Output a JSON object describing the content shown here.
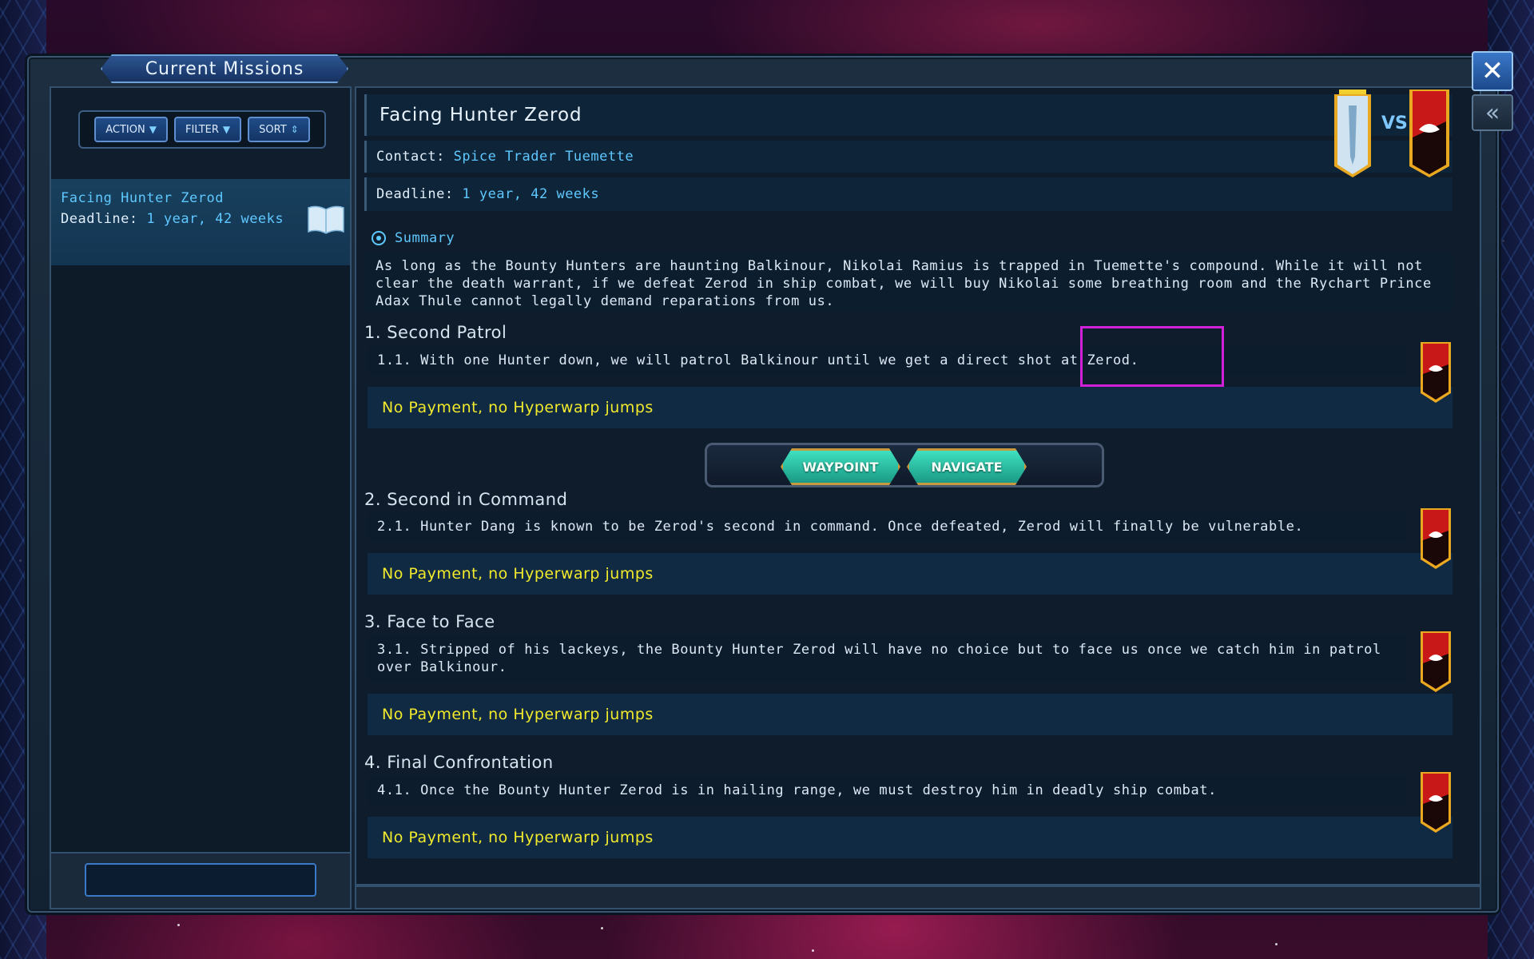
{
  "window": {
    "title": "Current Missions",
    "close_label": "✕",
    "collapse_label": "«"
  },
  "toolbar": {
    "action_label": "ACTION",
    "filter_label": "FILTER",
    "sort_label": "SORT"
  },
  "mission_list": [
    {
      "title": "Facing Hunter Zerod",
      "deadline_label": "Deadline:",
      "deadline_value": "1 year, 42 weeks"
    }
  ],
  "detail": {
    "title": "Facing Hunter Zerod",
    "contact_label": "Contact:",
    "contact_value": "Spice Trader Tuemette",
    "deadline_label": "Deadline:",
    "deadline_value": "1 year, 42 weeks",
    "vs_label": "VS",
    "summary_label": "Summary",
    "summary_text": "As long as the Bounty Hunters are haunting Balkinour, Nikolai Ramius is trapped in Tuemette's compound. While it will not clear the death warrant, if we defeat Zerod in ship combat, we will buy Nikolai some breathing room and the Rychart Prince Adax Thule cannot legally demand reparations from us."
  },
  "steps": [
    {
      "title": "1. Second Patrol",
      "desc": "1.1. With one Hunter down, we will patrol Balkinour until we get a direct shot at Zerod.",
      "payment": "No Payment, no Hyperwarp jumps"
    },
    {
      "title": "2. Second in Command",
      "desc": "2.1. Hunter Dang is known to be Zerod's second in command. Once defeated, Zerod will finally be vulnerable.",
      "payment": "No Payment, no Hyperwarp jumps"
    },
    {
      "title": "3. Face to Face",
      "desc": "3.1. Stripped of his lackeys, the Bounty Hunter Zerod will have no choice but to face us once we catch him in patrol over Balkinour.",
      "payment": "No Payment, no Hyperwarp jumps"
    },
    {
      "title": "4. Final Confrontation",
      "desc": "4.1. Once the Bounty Hunter Zerod is in hailing range, we must destroy him in deadly ship combat.",
      "payment": "No Payment, no Hyperwarp jumps"
    }
  ],
  "nav": {
    "waypoint_label": "WAYPOINT",
    "navigate_label": "NAVIGATE"
  },
  "colors": {
    "accent_cyan": "#5ec8ff",
    "payment_yellow": "#f2ea2c",
    "highlight_magenta": "#d020d8"
  }
}
